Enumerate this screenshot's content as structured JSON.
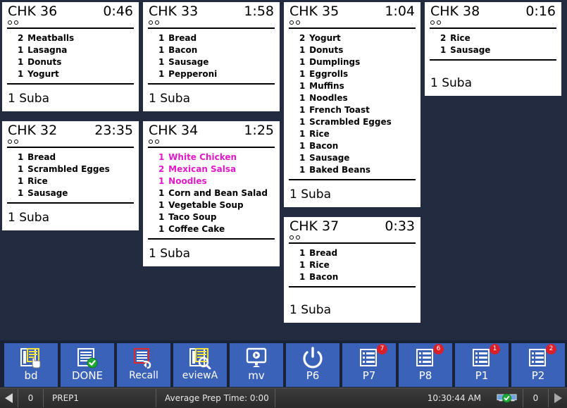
{
  "app": {
    "background_color": "#222b40",
    "ticket_bg": "#ffffff",
    "highlight_color": "#e119c9",
    "toolbar_bg": "#1a2235",
    "button_color": "#3a62b8",
    "badge_color": "#d9202a"
  },
  "columns": [
    {
      "tickets": [
        {
          "check_label": "CHK 36",
          "time": "0:46",
          "dots": 2,
          "items": [
            {
              "qty": "2",
              "name": "Meatballs",
              "highlight": false
            },
            {
              "qty": "1",
              "name": "Lasagna",
              "highlight": false
            },
            {
              "qty": "1",
              "name": "Donuts",
              "highlight": false
            },
            {
              "qty": "1",
              "name": "Yogurt",
              "highlight": false
            }
          ],
          "footer": "1 Suba"
        },
        {
          "check_label": "CHK 32",
          "time": "23:35",
          "dots": 2,
          "items": [
            {
              "qty": "1",
              "name": "Bread",
              "highlight": false
            },
            {
              "qty": "1",
              "name": "Scrambled Egges",
              "highlight": false
            },
            {
              "qty": "1",
              "name": "Rice",
              "highlight": false
            },
            {
              "qty": "1",
              "name": "Sausage",
              "highlight": false
            }
          ],
          "footer": "1 Suba"
        }
      ]
    },
    {
      "tickets": [
        {
          "check_label": "CHK 33",
          "time": "1:58",
          "dots": 2,
          "items": [
            {
              "qty": "1",
              "name": "Bread",
              "highlight": false
            },
            {
              "qty": "1",
              "name": "Bacon",
              "highlight": false
            },
            {
              "qty": "1",
              "name": "Sausage",
              "highlight": false
            },
            {
              "qty": "1",
              "name": "Pepperoni",
              "highlight": false
            }
          ],
          "footer": "1 Suba"
        },
        {
          "check_label": "CHK 34",
          "time": "1:25",
          "dots": 2,
          "items": [
            {
              "qty": "1",
              "name": "White Chicken",
              "highlight": true
            },
            {
              "qty": "2",
              "name": "Mexican Salsa",
              "highlight": true
            },
            {
              "qty": "1",
              "name": "Noodles",
              "highlight": true
            },
            {
              "qty": "1",
              "name": "Corn and Bean Salad",
              "highlight": false
            },
            {
              "qty": "1",
              "name": "Vegetable Soup",
              "highlight": false
            },
            {
              "qty": "1",
              "name": "Taco Soup",
              "highlight": false
            },
            {
              "qty": "1",
              "name": "Coffee Cake",
              "highlight": false
            }
          ],
          "footer": "1 Suba"
        }
      ]
    },
    {
      "tickets": [
        {
          "check_label": "CHK 35",
          "time": "1:04",
          "dots": 2,
          "items": [
            {
              "qty": "2",
              "name": "Yogurt",
              "highlight": false
            },
            {
              "qty": "1",
              "name": "Donuts",
              "highlight": false
            },
            {
              "qty": "1",
              "name": "Dumplings",
              "highlight": false
            },
            {
              "qty": "1",
              "name": "Eggrolls",
              "highlight": false
            },
            {
              "qty": "1",
              "name": "Muffins",
              "highlight": false
            },
            {
              "qty": "1",
              "name": "Noodles",
              "highlight": false
            },
            {
              "qty": "1",
              "name": "French Toast",
              "highlight": false
            },
            {
              "qty": "1",
              "name": "Scrambled Egges",
              "highlight": false
            },
            {
              "qty": "1",
              "name": "Rice",
              "highlight": false
            },
            {
              "qty": "1",
              "name": "Bacon",
              "highlight": false
            },
            {
              "qty": "1",
              "name": "Sausage",
              "highlight": false
            },
            {
              "qty": "1",
              "name": "Baked Beans",
              "highlight": false
            }
          ],
          "footer": "1 Suba"
        },
        {
          "check_label": "CHK 37",
          "time": "0:33",
          "dots": 2,
          "items": [
            {
              "qty": "1",
              "name": "Bread",
              "highlight": false
            },
            {
              "qty": "1",
              "name": "Rice",
              "highlight": false
            },
            {
              "qty": "1",
              "name": "Bacon",
              "highlight": false
            }
          ],
          "footer": "1 Suba"
        }
      ]
    },
    {
      "tickets": [
        {
          "check_label": "CHK 38",
          "time": "0:16",
          "dots": 2,
          "items": [
            {
              "qty": "2",
              "name": "Rice",
              "highlight": false
            },
            {
              "qty": "1",
              "name": "Sausage",
              "highlight": false
            }
          ],
          "footer": "1 Suba"
        }
      ]
    }
  ],
  "toolbar": {
    "buttons": [
      {
        "label": "bd",
        "icon": "document-hand-icon",
        "badge": null
      },
      {
        "label": "DONE",
        "icon": "document-check-icon",
        "badge": null
      },
      {
        "label": "Recall",
        "icon": "document-recall-icon",
        "badge": null
      },
      {
        "label": "eviewA",
        "icon": "document-search-icon",
        "badge": null
      },
      {
        "label": "mv",
        "icon": "monitor-icon",
        "badge": null
      },
      {
        "label": "P6",
        "icon": "power-icon",
        "badge": null
      },
      {
        "label": "P7",
        "icon": "list-document-icon",
        "badge": "7"
      },
      {
        "label": "P8",
        "icon": "list-document-icon",
        "badge": "6"
      },
      {
        "label": "P1",
        "icon": "list-document-icon",
        "badge": "1"
      },
      {
        "label": "P2",
        "icon": "list-document-icon",
        "badge": "2"
      }
    ]
  },
  "status_bar": {
    "prev_arrow": "left-triangle-icon",
    "left_count": "0",
    "station": "PREP1",
    "average_prep": "Average Prep Time: 0:00",
    "clock": "10:30:44 AM",
    "network_icon": "network-ok-icon",
    "right_count": "0",
    "next_arrow": "right-triangle-icon"
  }
}
